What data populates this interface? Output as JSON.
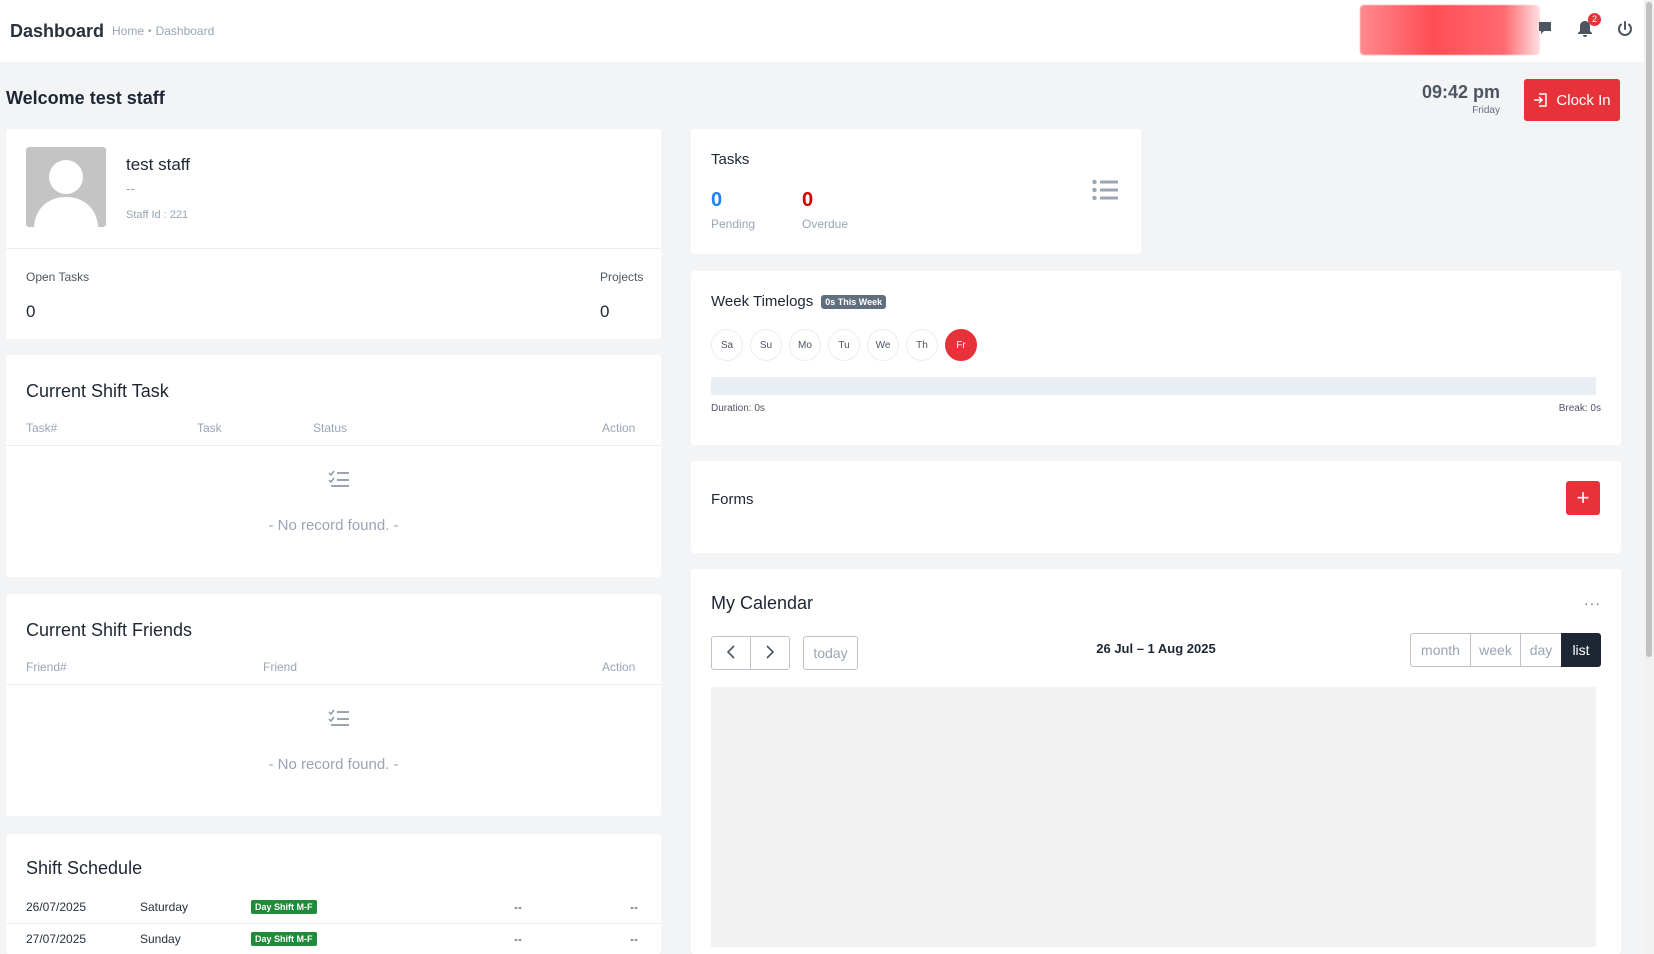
{
  "header": {
    "title": "Dashboard",
    "breadcrumb": {
      "home": "Home",
      "separator": "•",
      "current": "Dashboard"
    },
    "notification_count": "2",
    "icons": [
      "chat-icon",
      "bell-icon",
      "power-icon"
    ]
  },
  "welcome": "Welcome test staff",
  "clock": {
    "time": "09:42 pm",
    "day": "Friday",
    "button_label": "Clock In"
  },
  "profile": {
    "name": "test staff",
    "designation": "--",
    "staff_id": "Staff Id : 221",
    "open_tasks_label": "Open Tasks",
    "open_tasks_value": "0",
    "projects_label": "Projects",
    "projects_value": "0"
  },
  "tasks": {
    "title": "Tasks",
    "pending_value": "0",
    "pending_label": "Pending",
    "overdue_value": "0",
    "overdue_label": "Overdue",
    "colors": {
      "pending": "#1d82f5",
      "overdue": "#d30000"
    }
  },
  "current_shift_task": {
    "title": "Current Shift Task",
    "columns": [
      "Task#",
      "Task",
      "Status",
      "Action"
    ],
    "empty": "- No record found. -"
  },
  "current_shift_friends": {
    "title": "Current Shift Friends",
    "columns": [
      "Friend#",
      "Friend",
      "Action"
    ],
    "empty": "- No record found. -"
  },
  "shift_schedule": {
    "title": "Shift Schedule",
    "rows": [
      {
        "date": "26/07/2025",
        "day": "Saturday",
        "shift": "Day Shift M-F",
        "col4": "--",
        "col5": "--"
      },
      {
        "date": "27/07/2025",
        "day": "Sunday",
        "shift": "Day Shift M-F",
        "col4": "--",
        "col5": "--"
      }
    ]
  },
  "week_timelogs": {
    "title": "Week Timelogs",
    "badge": "0s This Week",
    "days": [
      "Sa",
      "Su",
      "Mo",
      "Tu",
      "We",
      "Th",
      "Fr"
    ],
    "active_day": "Fr",
    "duration": "Duration: 0s",
    "break": "Break: 0s"
  },
  "forms": {
    "title": "Forms",
    "add_label": "+"
  },
  "calendar": {
    "title": "My Calendar",
    "more": "···",
    "prev": "‹",
    "next": "›",
    "today": "today",
    "range": "26 Jul – 1 Aug 2025",
    "views": [
      "month",
      "week",
      "day",
      "list"
    ],
    "active_view": "list"
  },
  "accent": "#e8323a"
}
